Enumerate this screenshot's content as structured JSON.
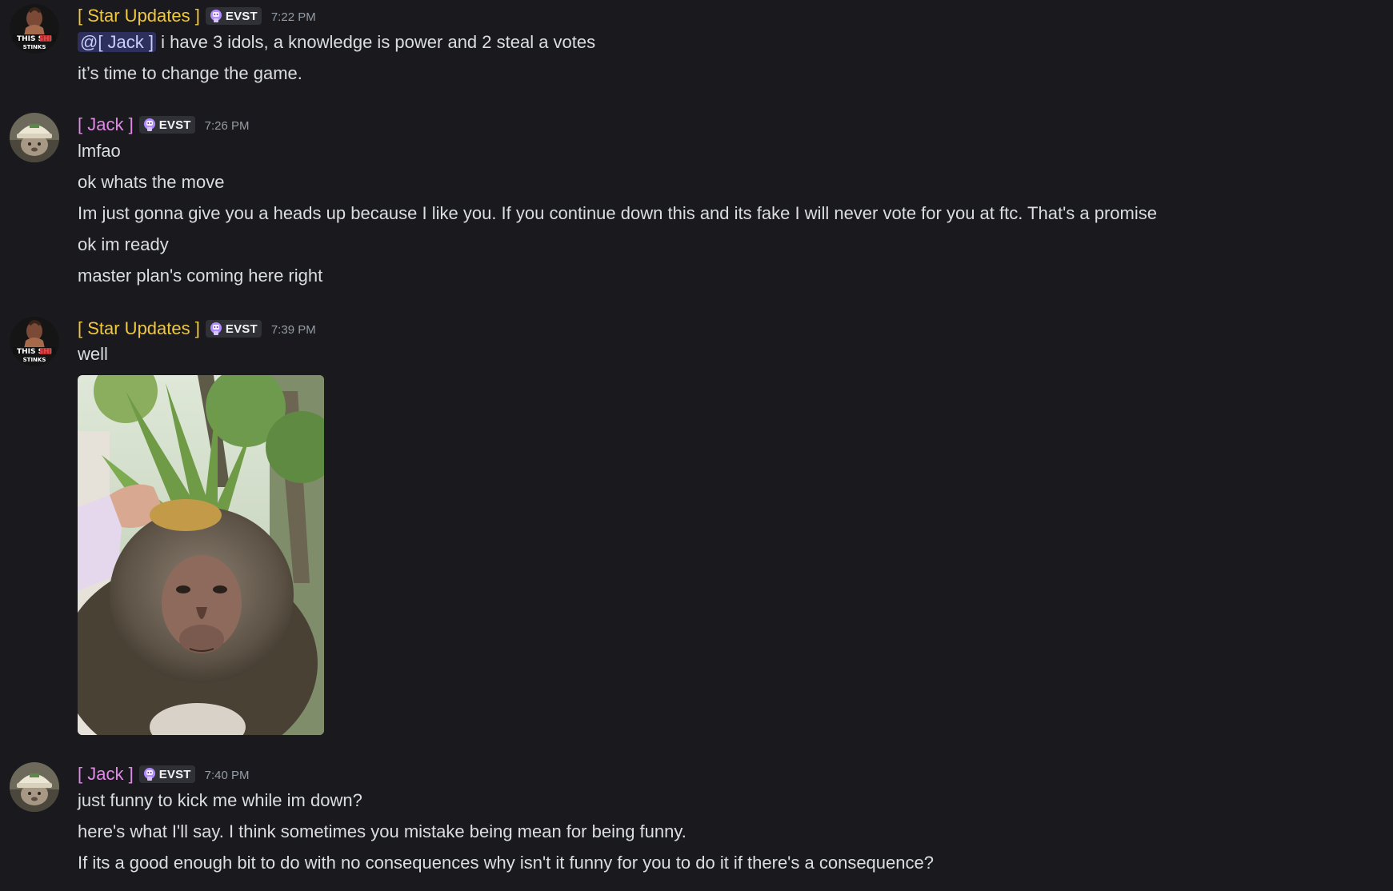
{
  "colors": {
    "background": "#1a1a1e",
    "star_updates_name": "#f0c83e",
    "jack_name": "#e08ae6",
    "mention_bg": "#3c4270",
    "timestamp": "#949ba4"
  },
  "messages": [
    {
      "author": "[ Star Updates ]",
      "role_tag": "EVST",
      "role_icon": "evst-badge-icon",
      "timestamp": "7:22 PM",
      "mention": "@[ Jack ]",
      "lines": [
        " i have 3 idols, a knowledge is power and 2 steal a votes",
        "it’s time to change the game."
      ]
    },
    {
      "author": "[ Jack ]",
      "role_tag": "EVST",
      "role_icon": "evst-badge-icon",
      "timestamp": "7:26 PM",
      "lines": [
        "lmfao",
        "ok whats the move",
        "Im just gonna give you a heads up because I like you. If you continue down this and its fake I will never vote for you at ftc. That's a promise",
        "ok im ready",
        "master plan's coming here right"
      ]
    },
    {
      "author": "[ Star Updates ]",
      "role_tag": "EVST",
      "role_icon": "evst-badge-icon",
      "timestamp": "7:39 PM",
      "lines": [
        "well"
      ],
      "attachment": "monkey-with-pineapple-image"
    },
    {
      "author": "[ Jack ]",
      "role_tag": "EVST",
      "role_icon": "evst-badge-icon",
      "timestamp": "7:40 PM",
      "lines": [
        "just funny to kick me while im down?",
        "here's what I'll say. I think sometimes you mistake being mean for being funny.",
        "If its a good enough bit to do with no consequences why isn't it funny for you to do it if there's a consequence?"
      ]
    }
  ]
}
